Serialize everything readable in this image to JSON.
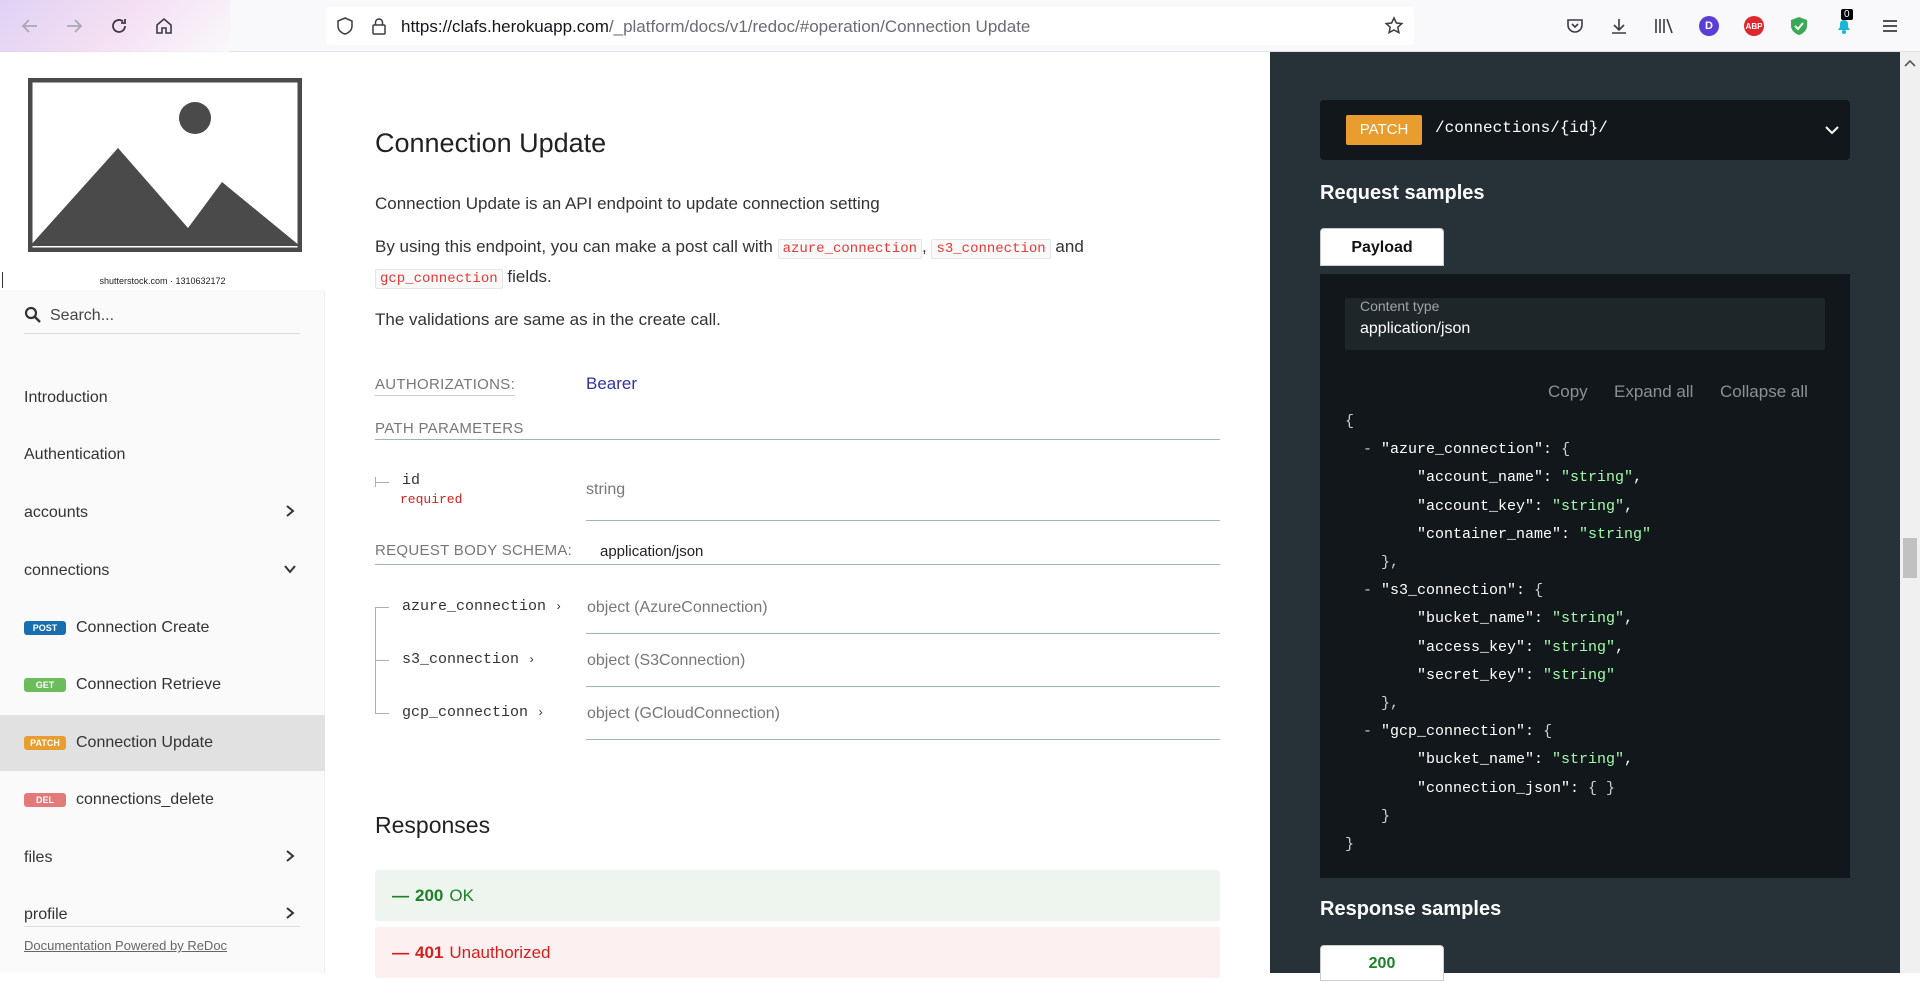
{
  "browser": {
    "url_host": "https://clafs.herokuapp.com",
    "url_path": "/_platform/docs/v1/redoc/#operation/Connection Update",
    "extension_d": "D",
    "extension_abp": "ABP",
    "notification_count": "0"
  },
  "sidebar": {
    "logo_caption": "shutterstock.com · 1310632172",
    "search_placeholder": "Search...",
    "items": [
      {
        "label": "Introduction"
      },
      {
        "label": "Authentication"
      },
      {
        "label": "accounts"
      },
      {
        "label": "connections"
      },
      {
        "label": "Connection Create",
        "method": "POST",
        "color": "#186FAF"
      },
      {
        "label": "Connection Retrieve",
        "method": "GET",
        "color": "#2F8132"
      },
      {
        "label": "Connection Update",
        "method": "PATCH",
        "color": "#BF581D"
      },
      {
        "label": "connections_delete",
        "method": "DEL",
        "color": "#CC3333"
      },
      {
        "label": "files"
      },
      {
        "label": "profile"
      }
    ],
    "powered_by": "Documentation Powered by ReDoc"
  },
  "main": {
    "title": "Connection Update",
    "intro": "Connection Update is an API endpoint to update connection setting",
    "para2_before": "By using this endpoint, you can make a post call with",
    "code_azure": "azure_connection",
    "comma": ",",
    "code_s3": "s3_connection",
    "and": "and",
    "code_gcp": "gcp_connection",
    "fields_suffix": "fields.",
    "validations": "The validations are same as in the create call.",
    "authorizations_label": "AUTHORIZATIONS:",
    "authorizations_value": "Bearer",
    "path_params_label": "PATH PARAMETERS",
    "path_param": {
      "name": "id",
      "required": "required",
      "type": "string"
    },
    "body_schema_label": "REQUEST BODY SCHEMA:",
    "body_schema_value": "application/json",
    "body_params": [
      {
        "name": "azure_connection",
        "type": "object (AzureConnection)"
      },
      {
        "name": "s3_connection",
        "type": "object (S3Connection)"
      },
      {
        "name": "gcp_connection",
        "type": "object (GCloudConnection)"
      }
    ],
    "responses_title": "Responses",
    "responses": [
      {
        "code": "200",
        "text": "OK",
        "bg": "#edf5ee",
        "color": "#1d8127"
      },
      {
        "code": "401",
        "text": "Unauthorized",
        "bg": "#fdf0f0",
        "color": "#d41f1c"
      }
    ],
    "dash": "—"
  },
  "right": {
    "method": "PATCH",
    "path": "/connections/{id}/",
    "request_samples": "Request samples",
    "payload_tab": "Payload",
    "content_type_label": "Content type",
    "content_type_value": "application/json",
    "copy": "Copy",
    "expand_all": "Expand all",
    "collapse_all": "Collapse all",
    "response_samples": "Response samples",
    "response_tab": "200",
    "accent_color": "#e99d2f"
  }
}
